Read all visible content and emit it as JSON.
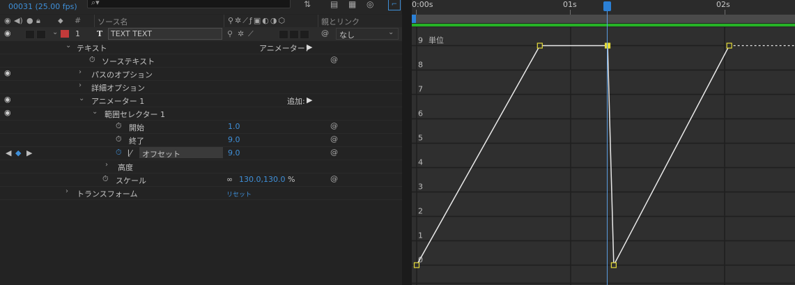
{
  "header": {
    "comp_name": "",
    "timecode": "00031 (25.00 fps)",
    "search_value": ""
  },
  "columns": {
    "source_name": "ソース名",
    "parent_link": "親とリンク",
    "number_hash": "#"
  },
  "layer": {
    "number": "1",
    "type_icon": "T",
    "name": "TEXT TEXT",
    "parent_value": "なし"
  },
  "rows": {
    "text": "テキスト",
    "animator_menu": "アニメーター：",
    "source_text": "ソーステキスト",
    "path_options": "パスのオプション",
    "more_options": "詳細オプション",
    "animator1": "アニメーター 1",
    "add_label": "追加:",
    "range_selector": "範囲セレクター 1",
    "start": "開始",
    "start_value": "1.0",
    "end": "終了",
    "end_value": "9.0",
    "offset": "オフセット",
    "offset_value": "9.0",
    "advanced": "高度",
    "scale": "スケール",
    "scale_value": "130.0,130.0",
    "scale_unit": "%",
    "transform": "トランスフォーム",
    "transform_reset": "リセット"
  },
  "timeline": {
    "ruler_labels": [
      "0:00s",
      "01s",
      "02s"
    ],
    "y_unit": "単位",
    "y_labels": [
      "9",
      "8",
      "7",
      "6",
      "5",
      "4",
      "3",
      "2",
      "1",
      "0"
    ]
  },
  "chart_data": {
    "type": "line",
    "series": [
      {
        "values": [
          [
            0,
            0
          ],
          [
            0.8,
            9
          ],
          [
            1.24,
            9
          ],
          [
            1.28,
            0
          ],
          [
            2.03,
            9
          ],
          [
            2.5,
            9
          ]
        ]
      }
    ],
    "xlim": [
      0,
      2.5
    ],
    "ylim": [
      0,
      9
    ]
  },
  "colors": {
    "accent": "#3f8fd8",
    "label_red": "#c23a3a",
    "green_bar": "#26b226",
    "keyframe": "#e6dc3a",
    "curve": "#e9e9e9"
  }
}
